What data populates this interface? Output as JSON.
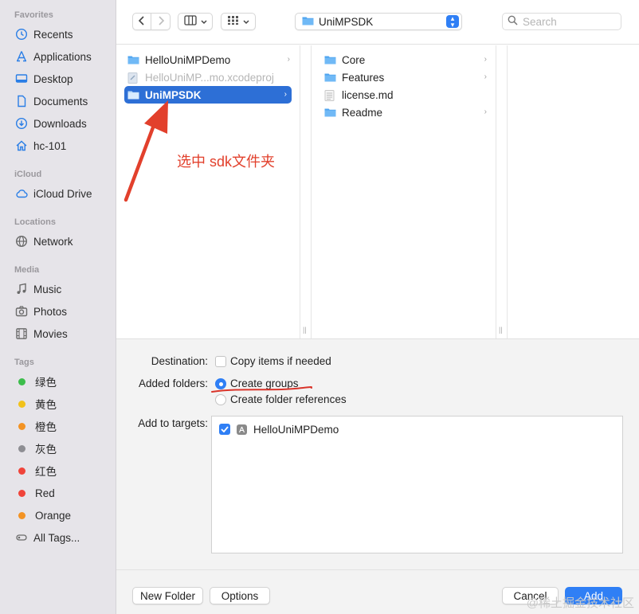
{
  "sidebar": {
    "favorites_title": "Favorites",
    "favorites": [
      {
        "label": "Recents",
        "icon": "clock-icon"
      },
      {
        "label": "Applications",
        "icon": "applications-icon"
      },
      {
        "label": "Desktop",
        "icon": "desktop-icon"
      },
      {
        "label": "Documents",
        "icon": "document-icon"
      },
      {
        "label": "Downloads",
        "icon": "download-icon"
      },
      {
        "label": "hc-101",
        "icon": "home-icon"
      }
    ],
    "icloud_title": "iCloud",
    "icloud": [
      {
        "label": "iCloud Drive",
        "icon": "cloud-icon"
      }
    ],
    "locations_title": "Locations",
    "locations": [
      {
        "label": "Network",
        "icon": "globe-icon"
      }
    ],
    "media_title": "Media",
    "media": [
      {
        "label": "Music",
        "icon": "music-note-icon"
      },
      {
        "label": "Photos",
        "icon": "camera-icon"
      },
      {
        "label": "Movies",
        "icon": "film-icon"
      }
    ],
    "tags_title": "Tags",
    "tags": [
      {
        "label": "绿色",
        "color": "#3cbd4b"
      },
      {
        "label": "黄色",
        "color": "#f2c21b"
      },
      {
        "label": "橙色",
        "color": "#f39324"
      },
      {
        "label": "灰色",
        "color": "#8e8e93"
      },
      {
        "label": "红色",
        "color": "#f0443a"
      },
      {
        "label": "Red",
        "color": "#f0443a"
      },
      {
        "label": "Orange",
        "color": "#f39324"
      }
    ],
    "all_tags": "All Tags..."
  },
  "toolbar": {
    "path_label": "UniMPSDK",
    "search_placeholder": "Search"
  },
  "column1": [
    {
      "label": "HelloUniMPDemo",
      "kind": "folder",
      "state": "normal",
      "chevron": true
    },
    {
      "label": "HelloUniMP...mo.xcodeproj",
      "kind": "xcodeproj",
      "state": "dimmed",
      "chevron": false
    },
    {
      "label": "UniMPSDK",
      "kind": "folder",
      "state": "selected",
      "chevron": true
    }
  ],
  "column2": [
    {
      "label": "Core",
      "kind": "folder",
      "chevron": true
    },
    {
      "label": "Features",
      "kind": "folder",
      "chevron": true
    },
    {
      "label": "license.md",
      "kind": "file",
      "chevron": false
    },
    {
      "label": "Readme",
      "kind": "folder",
      "chevron": true
    }
  ],
  "options": {
    "destination_label": "Destination:",
    "copy_items_label": "Copy items if needed",
    "copy_items_checked": false,
    "added_folders_label": "Added folders:",
    "create_groups_label": "Create groups",
    "create_references_label": "Create folder references",
    "selected_option": "Create groups",
    "targets_label": "Add to targets:",
    "targets": [
      {
        "label": "HelloUniMPDemo",
        "checked": true
      }
    ]
  },
  "buttons": {
    "new_folder": "New Folder",
    "options": "Options",
    "cancel": "Cancel",
    "add": "Add"
  },
  "annotation": {
    "text": "选中 sdk文件夹",
    "color": "#e2402c"
  },
  "watermark": "@稀土掘金技术社区"
}
